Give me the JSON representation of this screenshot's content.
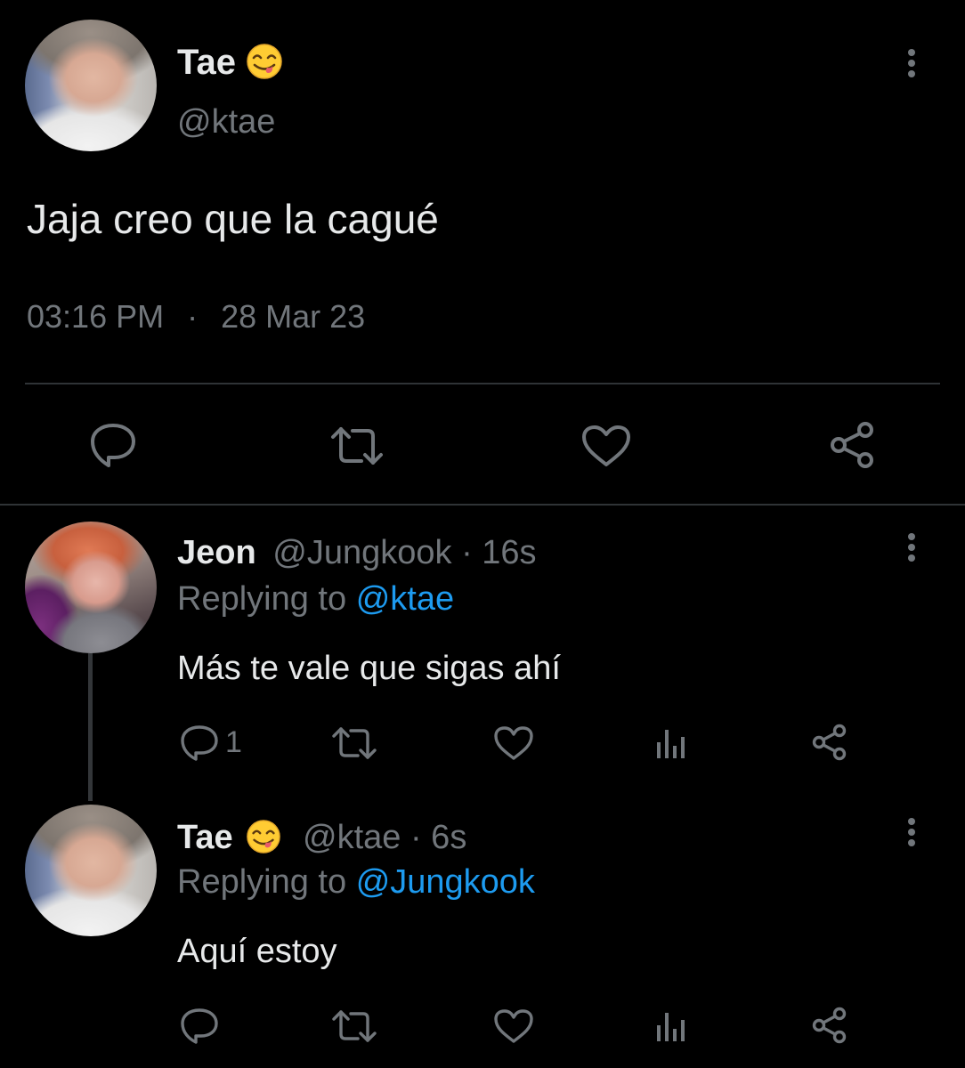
{
  "main_tweet": {
    "display_name": "Tae",
    "name_emoji": "face-savoring-food-emoji",
    "handle": "@ktae",
    "text": "Jaja creo que la cagué",
    "time": "03:16 PM",
    "separator": "·",
    "date": "28 Mar 23",
    "icons": [
      "reply-icon",
      "retweet-icon",
      "like-icon",
      "share-icon",
      "more-icon"
    ]
  },
  "replies": [
    {
      "display_name": "Jeon",
      "handle": "@Jungkook",
      "age": "· 16s",
      "replying_prefix": "Replying to",
      "replying_to": "@ktae",
      "text": "Más te vale que sigas ahí",
      "reply_count": "1",
      "icons": [
        "reply-icon",
        "retweet-icon",
        "like-icon",
        "analytics-icon",
        "share-icon",
        "more-icon"
      ]
    },
    {
      "display_name": "Tae",
      "name_emoji": "face-savoring-food-emoji",
      "handle": "@ktae",
      "age": "· 6s",
      "replying_prefix": "Replying to",
      "replying_to": "@Jungkook",
      "text": "Aquí estoy",
      "icons": [
        "reply-icon",
        "retweet-icon",
        "like-icon",
        "analytics-icon",
        "share-icon",
        "more-icon"
      ]
    }
  ],
  "colors": {
    "background": "#000000",
    "primary_text": "#e7e9ea",
    "secondary_text": "#71767b",
    "link": "#1d9bf0",
    "divider": "#2f3336",
    "thread_line": "#333639"
  }
}
